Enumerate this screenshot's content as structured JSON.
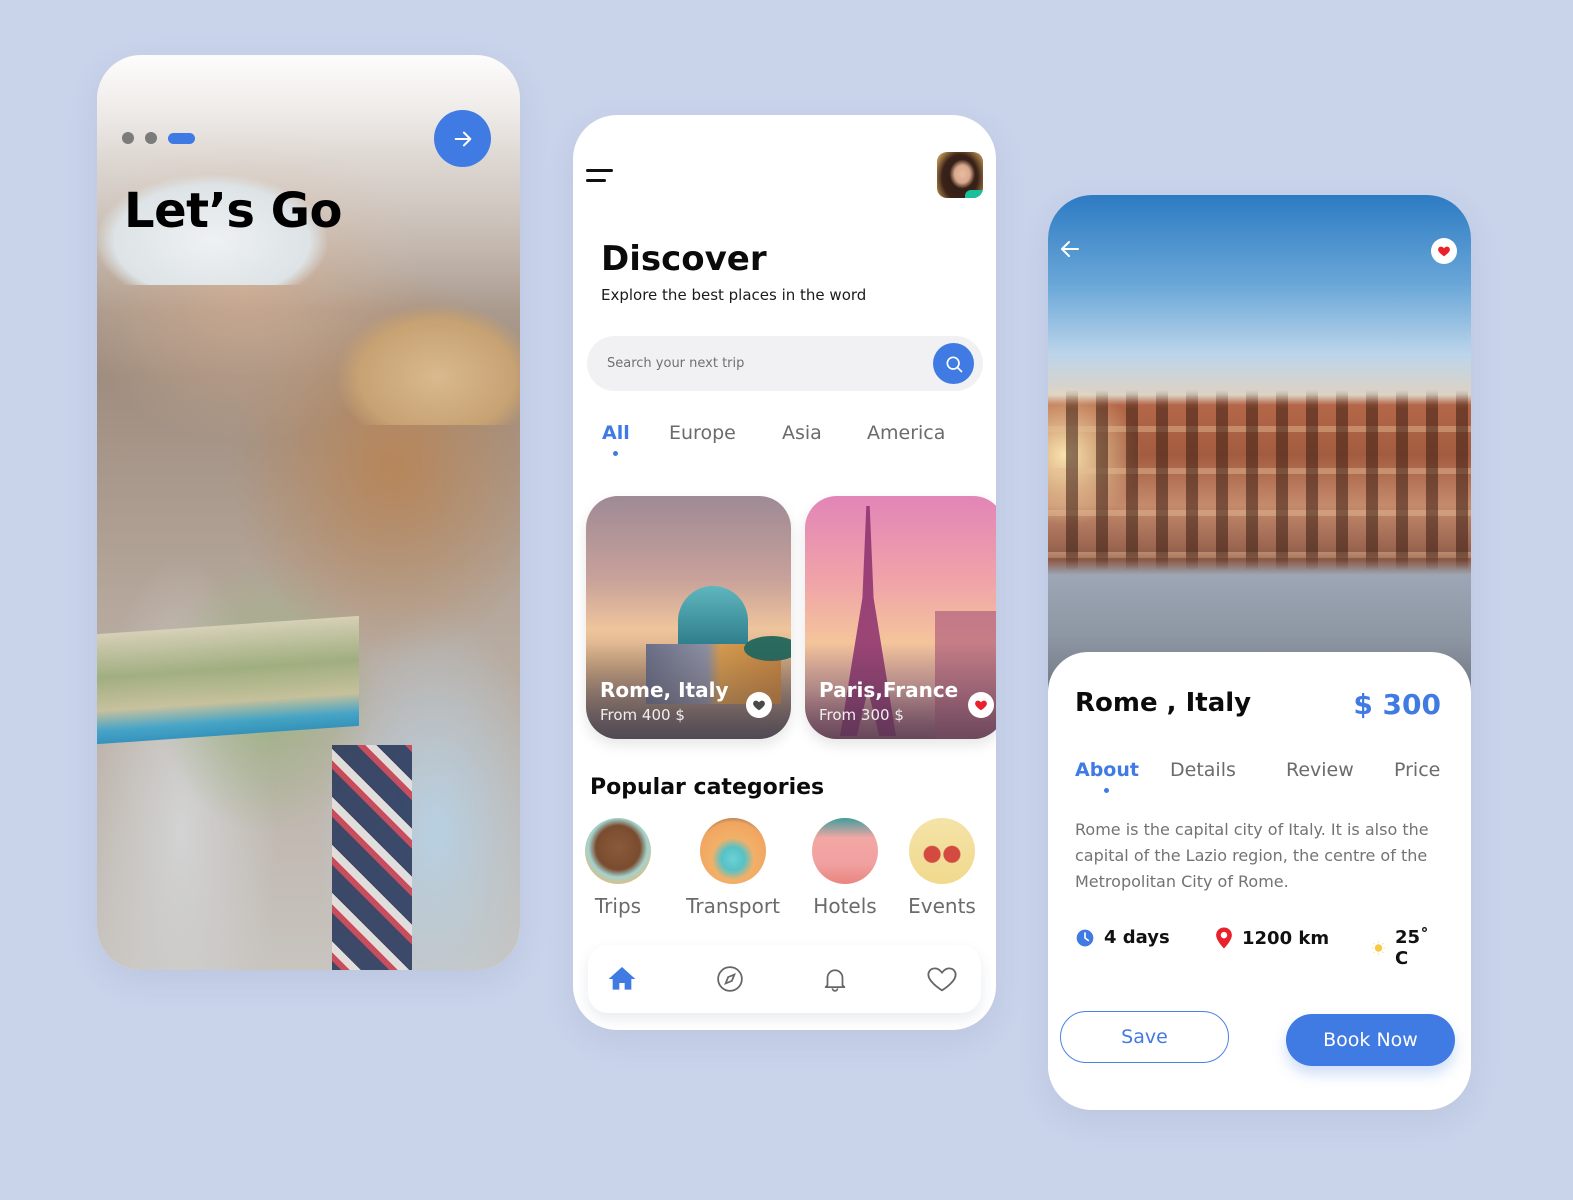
{
  "theme": {
    "background": "#c9d3ea",
    "accent": "#407ae3",
    "heart_red": "#e8212b",
    "pin_red": "#e8212b",
    "sun_yellow": "#f7c948"
  },
  "onboarding": {
    "title": "Let’s Go",
    "pager": {
      "total": 3,
      "active_index": 2
    },
    "next_icon": "arrow-right-icon"
  },
  "discover": {
    "menu_icon": "menu-icon",
    "avatar_alt": "User profile photo",
    "title": "Discover",
    "subtitle": "Explore the best places in the word",
    "search": {
      "placeholder": "Search your next trip",
      "value": "",
      "icon": "search-icon"
    },
    "region_tabs": [
      {
        "label": "All",
        "active": true
      },
      {
        "label": "Europe",
        "active": false
      },
      {
        "label": "Asia",
        "active": false
      },
      {
        "label": "America",
        "active": false
      }
    ],
    "destinations": [
      {
        "name": "Rome, Italy",
        "price": "From 400 $",
        "favorited": false
      },
      {
        "name": "Paris,France",
        "price": "From 300 $",
        "favorited": true
      }
    ],
    "categories_heading": "Popular categories",
    "categories": [
      {
        "label": "Trips"
      },
      {
        "label": "Transport"
      },
      {
        "label": "Hotels"
      },
      {
        "label": "Events"
      }
    ],
    "bottom_nav": [
      {
        "icon": "home-icon",
        "active": true
      },
      {
        "icon": "compass-icon",
        "active": false
      },
      {
        "icon": "bell-icon",
        "active": false
      },
      {
        "icon": "heart-icon",
        "active": false
      }
    ]
  },
  "detail": {
    "back_icon": "arrow-left-icon",
    "favorited": true,
    "title": "Rome , Italy",
    "price": "$ 300",
    "tabs": [
      {
        "label": "About",
        "active": true
      },
      {
        "label": "Details",
        "active": false
      },
      {
        "label": "Review",
        "active": false
      },
      {
        "label": "Price",
        "active": false
      }
    ],
    "description": "Rome is the capital city of Italy.  It is also the capital of the Lazio region, the centre of the Metropolitan City of Rome.",
    "stats": [
      {
        "icon": "clock-icon",
        "value": "4 days"
      },
      {
        "icon": "location-pin-icon",
        "value": "1200 km"
      },
      {
        "icon": "sun-icon",
        "value": "25˚ C"
      }
    ],
    "save_label": "Save",
    "book_label": "Book Now"
  }
}
